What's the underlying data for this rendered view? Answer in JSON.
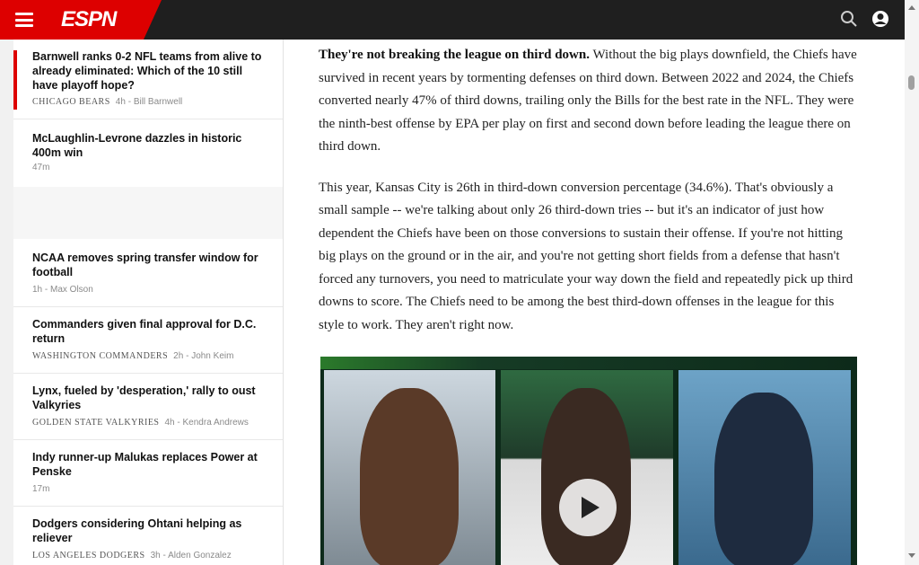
{
  "header": {
    "logo": "ESPN",
    "menu_icon": "hamburger-menu-icon",
    "search_icon": "search-icon",
    "profile_icon": "user-profile-icon"
  },
  "sidebar": {
    "stories": [
      {
        "title": "Barnwell ranks 0-2 NFL teams from alive to already eliminated: Which of the 10 still have playoff hope?",
        "team": "CHICAGO BEARS",
        "time": "4h",
        "author": "Bill Barnwell"
      },
      {
        "title": "McLaughlin-Levrone dazzles in historic 400m win",
        "team": "",
        "time": "47m",
        "author": ""
      },
      {
        "title": "NCAA removes spring transfer window for football",
        "team": "",
        "time": "1h",
        "author": "Max Olson"
      },
      {
        "title": "Commanders given final approval for D.C. return",
        "team": "WASHINGTON COMMANDERS",
        "time": "2h",
        "author": "John Keim"
      },
      {
        "title": "Lynx, fueled by 'desperation,' rally to oust Valkyries",
        "team": "GOLDEN STATE VALKYRIES",
        "time": "4h",
        "author": "Kendra Andrews"
      },
      {
        "title": "Indy runner-up Malukas replaces Power at Penske",
        "team": "",
        "time": "17m",
        "author": ""
      },
      {
        "title": "Dodgers considering Ohtani helping as reliever",
        "team": "LOS ANGELES DODGERS",
        "time": "3h",
        "author": "Alden Gonzalez"
      }
    ]
  },
  "article": {
    "p1_lead": "They're not breaking the league on third down.",
    "p1_body": " Without the big plays downfield, the Chiefs have survived in recent years by tormenting defenses on third down. Between 2022 and 2024, the Chiefs converted nearly 47% of third downs, trailing only the Bills for the best rate in the NFL. They were the ninth-best offense by EPA per play on first and second down before leading the league there on third down.",
    "p2": "This year, Kansas City is 26th in third-down conversion percentage (34.6%). That's obviously a small sample -- we're talking about only 26 third-down tries -- but it's an indicator of just how dependent the Chiefs have been on those conversions to sustain their offense. If you're not hitting big plays on the ground or in the air, and you're not getting short fields from a defense that hasn't forced any turnovers, you need to matriculate your way down the field and repeatedly pick up third downs to score. The Chiefs need to be among the best third-down offenses in the league for this style to work. They aren't right now."
  },
  "video": {
    "play_icon": "play-icon"
  },
  "colors": {
    "brand_red": "#dd0000",
    "header_bg": "#1f1f1f"
  }
}
